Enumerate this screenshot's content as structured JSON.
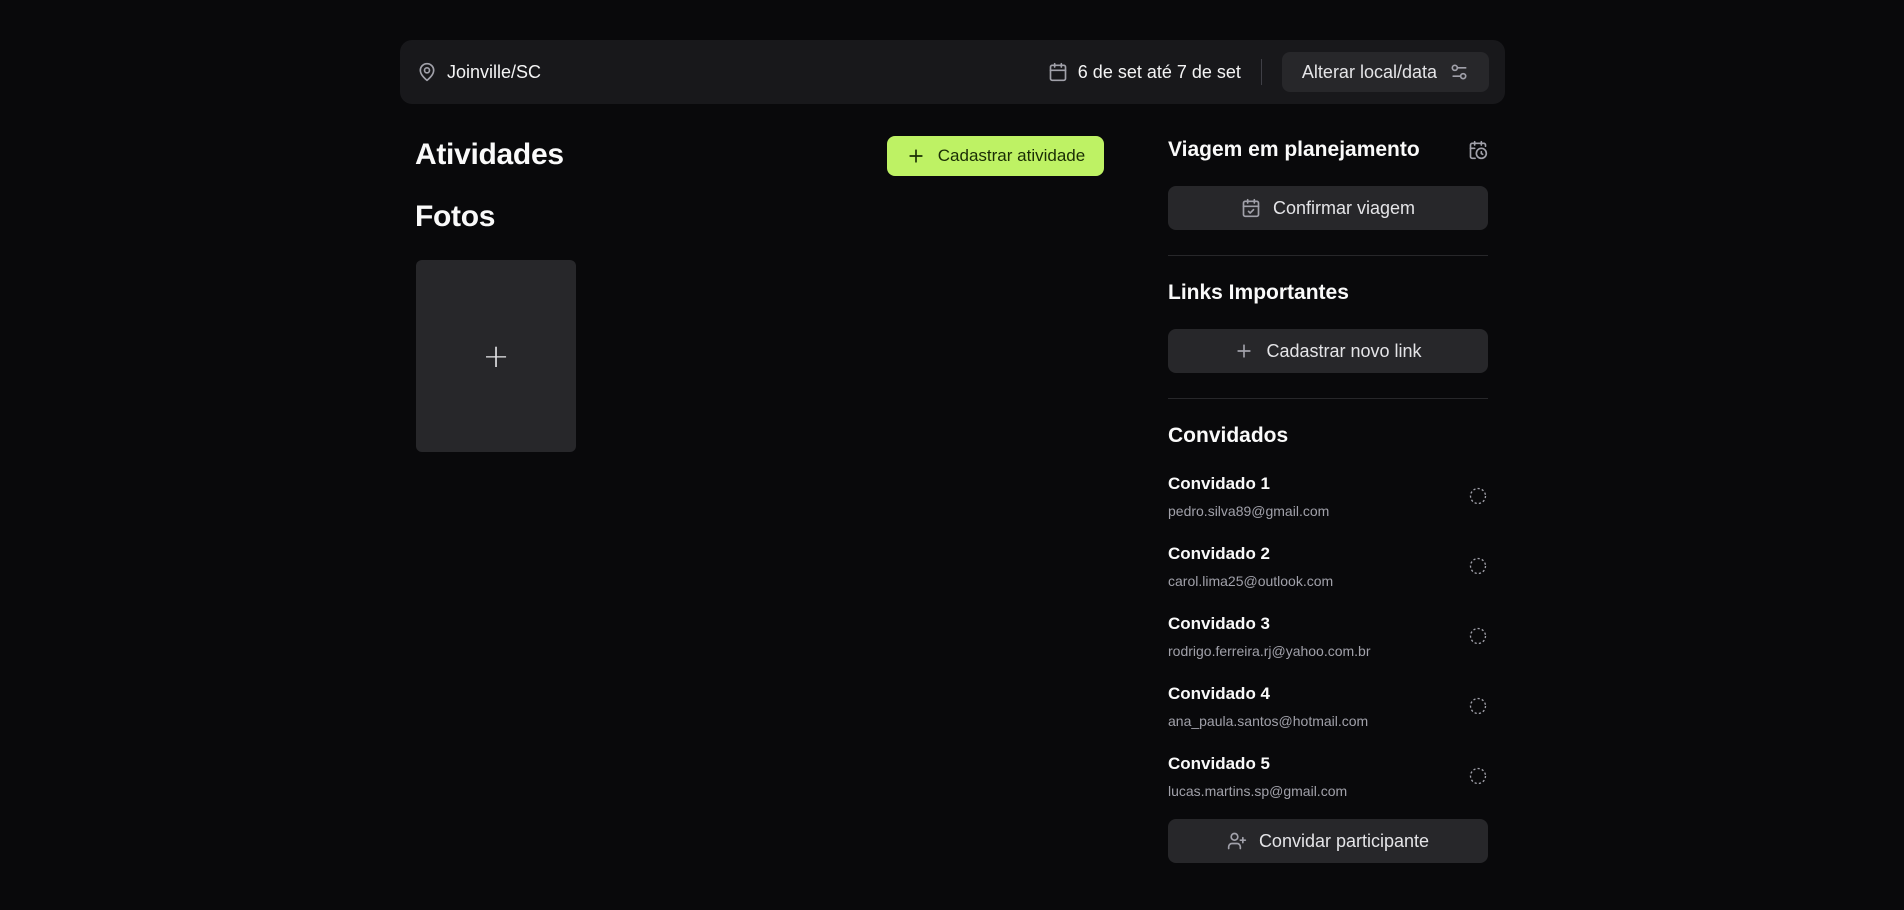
{
  "header": {
    "location": "Joinville/SC",
    "location_icon": "map-pin-icon",
    "dates": "6 de set até 7 de set",
    "dates_icon": "calendar-icon",
    "change_button_label": "Alterar local/data",
    "change_button_icon": "settings-sliders-icon"
  },
  "activities": {
    "title": "Atividades",
    "add_button_label": "Cadastrar atividade"
  },
  "photos": {
    "title": "Fotos",
    "add_symbol": "+"
  },
  "trip": {
    "status_title": "Viagem em planejamento",
    "confirm_label": "Confirmar viagem"
  },
  "links": {
    "title": "Links Importantes",
    "add_label": "Cadastrar novo link"
  },
  "guests": {
    "title": "Convidados",
    "items": [
      {
        "name": "Convidado 1",
        "email": "pedro.silva89@gmail.com"
      },
      {
        "name": "Convidado 2",
        "email": "carol.lima25@outlook.com"
      },
      {
        "name": "Convidado 3",
        "email": "rodrigo.ferreira.rj@yahoo.com.br"
      },
      {
        "name": "Convidado 4",
        "email": "ana_paula.santos@hotmail.com"
      },
      {
        "name": "Convidado 5",
        "email": "lucas.martins.sp@gmail.com"
      }
    ],
    "invite_label": "Convidar participante"
  },
  "colors": {
    "background": "#09090b",
    "surface": "#18181b",
    "button": "#27272a",
    "accent": "#bef264"
  }
}
